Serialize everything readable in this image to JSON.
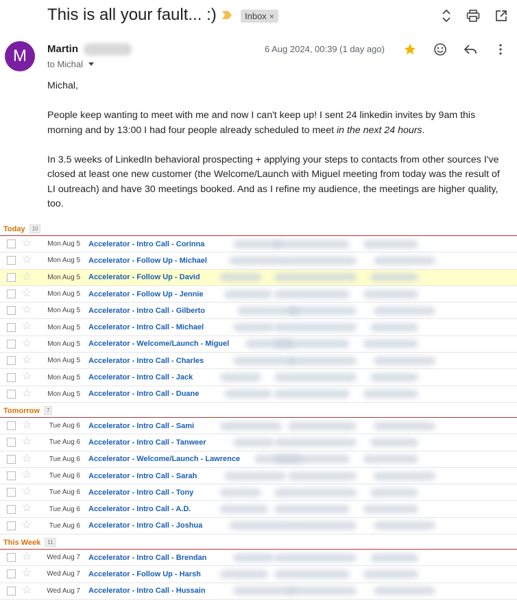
{
  "subject": "This is all your fault... :)",
  "label_chip": "Inbox",
  "label_chip_close": "×",
  "sender": {
    "name": "Martin",
    "avatar_letter": "M",
    "to_line": "to Michal",
    "date": "6 Aug 2024, 00:39 (1 day ago)"
  },
  "body": {
    "greeting": "Michal,",
    "p1_a": "People keep wanting to meet with me and now I can't keep up!  I sent 24 linkedin invites by 9am this morning and by 13:00 I had four people already scheduled to meet ",
    "p1_em": "in the next 24 hours",
    "p1_end": ".",
    "p2": "In 3.5 weeks of LinkedIn behavioral prospecting + applying your steps to contacts from other sources I've closed at least one new customer (the Welcome/Launch with Miguel meeting from today was the result of LI outreach) and have 30 meetings booked. And as I refine my audience, the meetings are higher quality, too."
  },
  "colors": {
    "avatar": "#7b1fa2",
    "section_title": "#dd6f00",
    "event_title": "#1a5fb4",
    "highlight": "#ffffcc",
    "star_filled": "#f4b400"
  },
  "sections": [
    {
      "title": "Today",
      "count": "10",
      "rows": [
        {
          "date": "Mon Aug 5",
          "title": "Accelerator - Intro Call - Corinna"
        },
        {
          "date": "Mon Aug 5",
          "title": "Accelerator - Follow Up - Michael"
        },
        {
          "date": "Mon Aug 5",
          "title": "Accelerator - Follow Up - David",
          "highlight": true
        },
        {
          "date": "Mon Aug 5",
          "title": "Accelerator - Follow Up - Jennie"
        },
        {
          "date": "Mon Aug 5",
          "title": "Accelerator - Intro Call - Gilberto"
        },
        {
          "date": "Mon Aug 5",
          "title": "Accelerator - Intro Call - Michael"
        },
        {
          "date": "Mon Aug 5",
          "title": "Accelerator - Welcome/Launch - Miguel"
        },
        {
          "date": "Mon Aug 5",
          "title": "Accelerator - Intro Call - Charles"
        },
        {
          "date": "Mon Aug 5",
          "title": "Accelerator - Intro Call - Jack"
        },
        {
          "date": "Mon Aug 5",
          "title": "Accelerator - Intro Call - Duane"
        }
      ]
    },
    {
      "title": "Tomorrow",
      "count": "7",
      "rows": [
        {
          "date": "Tue Aug 6",
          "title": "Accelerator - Intro Call - Sami"
        },
        {
          "date": "Tue Aug 6",
          "title": "Accelerator - Intro Call - Tanweer"
        },
        {
          "date": "Tue Aug 6",
          "title": "Accelerator - Welcome/Launch - Lawrence"
        },
        {
          "date": "Tue Aug 6",
          "title": "Accelerator - Intro Call - Sarah"
        },
        {
          "date": "Tue Aug 6",
          "title": "Accelerator - Intro Call - Tony"
        },
        {
          "date": "Tue Aug 6",
          "title": "Accelerator - Intro Call - A.D."
        },
        {
          "date": "Tue Aug 6",
          "title": "Accelerator - Intro Call - Joshua"
        }
      ]
    },
    {
      "title": "This Week",
      "count": "11",
      "rows": [
        {
          "date": "Wed Aug 7",
          "title": "Accelerator - Intro Call - Brendan"
        },
        {
          "date": "Wed Aug 7",
          "title": "Accelerator - Follow Up - Harsh"
        },
        {
          "date": "Wed Aug 7",
          "title": "Accelerator - Intro Call - Hussain"
        }
      ]
    }
  ]
}
